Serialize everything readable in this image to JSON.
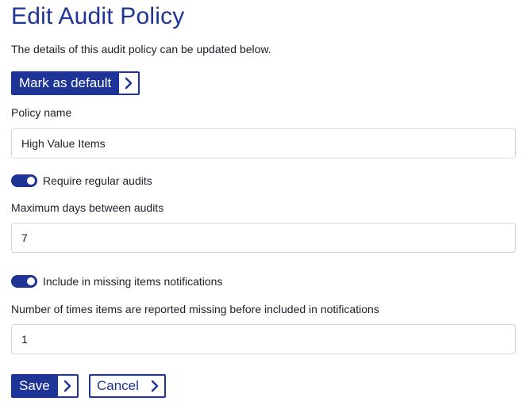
{
  "page": {
    "title": "Edit Audit Policy",
    "intro": "The details of this audit policy can be updated below."
  },
  "mark_default": {
    "label": "Mark as default",
    "icon": "chevron-right-icon"
  },
  "policy_name": {
    "label": "Policy name",
    "value": "High Value Items"
  },
  "require_audits": {
    "label": "Require regular audits",
    "enabled": true
  },
  "max_days": {
    "label": "Maximum days between audits",
    "value": "7"
  },
  "missing_notifications": {
    "label": "Include in missing items notifications",
    "enabled": true
  },
  "missing_count": {
    "label": "Number of times items are reported missing before included in notifications",
    "value": "1"
  },
  "actions": {
    "save_label": "Save",
    "cancel_label": "Cancel"
  },
  "colors": {
    "accent": "#1f3497",
    "border": "#d6d6dc",
    "text": "#1e1e2a"
  }
}
